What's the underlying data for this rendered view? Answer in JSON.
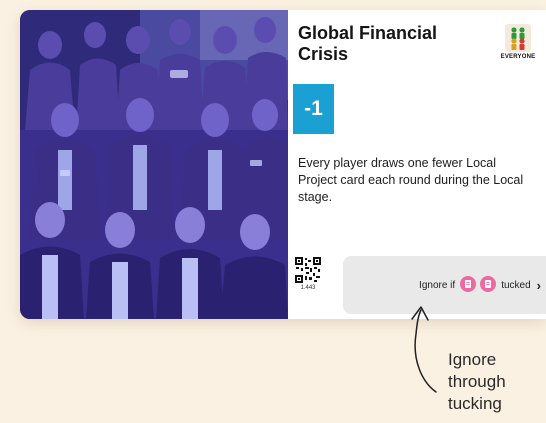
{
  "card": {
    "title": "Global Financial Crisis",
    "player_badge": {
      "icon": "two-players-icon",
      "label": "EVERYONE"
    },
    "modifier": "-1",
    "description": "Every player draws one fewer Local Project card each round during the Local stage.",
    "qr_code": "1.443",
    "ignore": {
      "prefix": "Ignore if",
      "suffix": "tucked",
      "icons": [
        "pink-card-icon",
        "pink-card-icon"
      ]
    }
  },
  "annotation": {
    "text": "Ignore through tucking"
  },
  "colors": {
    "modifier_bg": "#1aa0d2",
    "panel_bg": "#e9e9ea",
    "page_bg": "#fbf1e2",
    "tuck_icon": "#ec6aa0"
  }
}
